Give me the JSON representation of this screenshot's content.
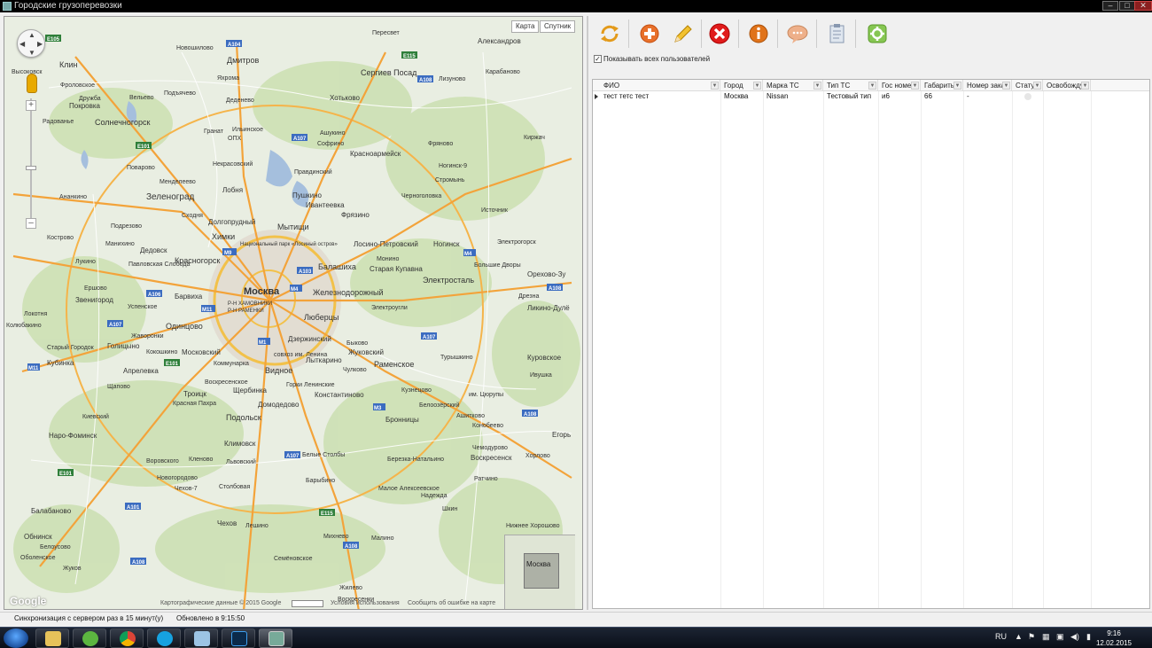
{
  "window": {
    "title": "Городские грузоперевозки",
    "controls": {
      "minimize": "–",
      "maximize": "□",
      "close": "✕"
    }
  },
  "map": {
    "type_buttons": {
      "map": "Карта",
      "satellite": "Спутник"
    },
    "pan_arrows": {
      "up": "▲",
      "down": "▼",
      "left": "◀",
      "right": "▶"
    },
    "zoom": {
      "in": "+",
      "out": "–"
    },
    "labels": {
      "peresvet": "Пересвет",
      "aleksandrov": "Александров",
      "novoshilovo": "Новошиловo",
      "dmitrov": "Дмитров",
      "sergiev_posad": "Сергиев Посад",
      "klin": "Клин",
      "frolovskoe": "Фроловское",
      "vysokovsk": "Высоковск",
      "yakhroma": "Яхрома",
      "karabanovo": "Карабаново",
      "lyzhino": "Лизуново",
      "druzhba": "Дружба",
      "velevo": "Вельево",
      "podyachevo": "Подъячево",
      "deledovo": "Деденево",
      "khotkovo": "Хотьково",
      "pokrovka": "Покровка",
      "solnechnogorsk": "Солнечногорск",
      "radovanye": "Радованье",
      "granat": "Гранат",
      "ashukino": "Ашукино",
      "kirzhach": "Киржач",
      "ilyinskoe": "Ильинское",
      "opkh": "ОПХ",
      "sofrino": "Софрино",
      "fryanovo": "Фряново",
      "nekrasovsky": "Некрасовский",
      "krasnoarmeysk": "Красноармейск",
      "povarovo": "Поварово",
      "pravdinsky": "Правдинский",
      "noginsk9": "Ногинск-9",
      "mendeleevo": "Менделеево",
      "stromyn": "Стромынь",
      "lobnya": "Лобня",
      "pushkino": "Пушкино",
      "anankino": "Ананкино",
      "zelenograd": "Зеленоград",
      "ivanteevka": "Ивантеевка",
      "chernogolovka": "Черноголовка",
      "skhodnya": "Сходня",
      "dolgoprudny": "Долгопрудный",
      "fryazino": "Фрязино",
      "istochnik": "Источник",
      "podrosno": "Подрезово",
      "khimki": "Химки",
      "mytishchi": "Мытищи",
      "park": "Национальный парк «Лосиный остров»",
      "losino": "Лосино-Петровский",
      "noginsk": "Ногинск",
      "elektrogorsk": "Электрогорск",
      "kostrovo": "Кострово",
      "manikhino": "Манихино",
      "dedovsk": "Дедовск",
      "monino": "Монино",
      "lukino": "Лукино",
      "pavlovskaya": "Павловская Слобода",
      "krasnogorsk": "Красногорск",
      "balashikha": "Балашиха",
      "bolshie_dvory": "Большие Дворы",
      "orekhovo": "Орехово-Зу",
      "staraya_kupavna": "Старая Купавна",
      "ershovo": "Ершово",
      "barvikha": "Барвиха",
      "moskva": "Москва",
      "zheleznodorozhny": "Железнодорожный",
      "elektrostal": "Электросталь",
      "zvenigorod": "Звенигород",
      "drezna": "Дрезна",
      "uspenskoe": "Успенское",
      "khamovniki": "Р-Н ХАМОВНИКИ",
      "ramenki": "Р-Н РАМЕНКИ",
      "lyubertsy": "Люберцы",
      "elektrougli": "Электроугли",
      "likino": "Ликино-Дулё",
      "lokotnya": "Локотня",
      "odintsovo": "Одинцово",
      "zhavoronki": "Жаворонки",
      "dzerzhinsky": "Дзержинский",
      "kolyubakino": "Колюбакино",
      "golitsyno": "Голицыно",
      "bykovo": "Быково",
      "zhukovsky": "Жуковский",
      "stary_gorodok": "Старый Городок",
      "kokoshkino": "Кокошкино",
      "moskovsky": "Московский",
      "turyshkino": "Турышкино",
      "kurovskoe": "Куровское",
      "kubinka": "Кубинка",
      "aprelevka": "Апрелевка",
      "kommunarka": "Коммунарка",
      "vidnoe": "Видное",
      "sovkhoz": "совхоз им. Ленина",
      "lytkarino": "Лыткарино",
      "chulkovo": "Чулково",
      "ramenskoe": "Раменское",
      "ivushka": "Ивушка",
      "shchapovo": "Щапово",
      "voskresenskoe": "Воскресенское",
      "gorki": "Горки Ленинские",
      "kuznetsovo": "Кузнецово",
      "troitsk": "Троицк",
      "shcherbinka": "Щербинка",
      "konstantinovo": "Константиново",
      "churupy": "им. Цюрупы",
      "krasnaya_pakhra": "Красная Пахра",
      "domodedovo": "Домодедово",
      "beloozersky": "Белоозёрский",
      "kievsky": "Киевский",
      "podolsk": "Подольск",
      "bronnitsy": "Бронницы",
      "ashitkovo": "Ашитково",
      "konobeevo": "Конобеево",
      "egorievsk": "Егорь",
      "naro_fominsk": "Наро-Фоминск",
      "klimovsk": "Климовск",
      "chemodurovo": "Чемодурово",
      "vorovsky": "Воровского",
      "klenovo": "Кленово",
      "lvovsky": "Львовский",
      "belye_stolby": "Белые Столбы",
      "berezka": "Березка-Натальино",
      "voskresensk": "Воскресенск",
      "khorlovo": "Хорлово",
      "novogorodovo": "Новогородово",
      "barybino": "Барыбино",
      "ratchino": "Ратчино",
      "chekhov7": "Чехов-7",
      "stolbovaya": "Столбовая",
      "maloe": "Малое Алексеевское",
      "nadezhda": "Надежда",
      "shkin": "Шкин",
      "balabanovo": "Балабаново",
      "chekhov": "Чехов",
      "leshino": "Лешино",
      "nizhne": "Нижнее Хорошово",
      "obninsk": "Обнинск",
      "belousovo": "Белоусово",
      "mikhnevo": "Михнево",
      "malino": "Малино",
      "semenovskoe": "Семёновское",
      "zhukov": "Жуков",
      "zhilevo": "Жилево",
      "voskresenki": "Воскресенки",
      "obolenskoe": "Оболенское"
    },
    "shields": [
      "E105",
      "A104",
      "E115",
      "A108",
      "A107",
      "E101",
      "A106",
      "M9",
      "M10",
      "M11",
      "M1",
      "M2",
      "M3",
      "M4",
      "M5",
      "M7",
      "M8",
      "A103",
      "A101",
      "A113",
      "A105"
    ],
    "mini_map_label": "Москва",
    "footer": {
      "copyright": "Картографические данные © 2015 Google",
      "scale": "",
      "terms": "Условия использования",
      "report": "Сообщить об ошибке на карте"
    },
    "logo": "Google"
  },
  "toolbar": {
    "buttons": [
      {
        "name": "refresh-button",
        "icon": "refresh-icon",
        "color": "#f0a020"
      },
      {
        "name": "add-button",
        "icon": "plus-icon",
        "color": "#e86a1c"
      },
      {
        "name": "edit-button",
        "icon": "pencil-icon",
        "color": "#e8b020"
      },
      {
        "name": "delete-button",
        "icon": "close-icon",
        "color": "#d81818"
      },
      {
        "name": "info-button",
        "icon": "info-icon",
        "color": "#e07010"
      },
      {
        "name": "message-button",
        "icon": "chat-icon",
        "color": "#e8a070"
      },
      {
        "name": "report-button",
        "icon": "clipboard-icon",
        "color": "#8898b0"
      },
      {
        "name": "settings-button",
        "icon": "gear-icon",
        "color": "#7ac040"
      }
    ]
  },
  "show_all_users": {
    "checked": "✓",
    "label": "Показывать всех пользователей"
  },
  "grid": {
    "columns": [
      "ФИО",
      "Город",
      "Марка ТС",
      "Тип ТС",
      "Гос номер",
      "Габариты",
      "Номер заказ",
      "Статус",
      "Освобождус"
    ],
    "rows": [
      {
        "fio": "тест тетс тест",
        "city": "Москва",
        "brand": "Nissan",
        "type": "Тестовый тип",
        "plate": "и6",
        "size": "66",
        "order": "-",
        "status": "",
        "free": ""
      }
    ]
  },
  "statusbar": {
    "sync": "Синхронизация с сервером раз в 15 минут(у)",
    "updated": "Обновлено в 9:15:50"
  },
  "taskbar": {
    "apps": [
      "explorer",
      "utorrent",
      "chrome",
      "skype",
      "notepad",
      "photoshop",
      "app"
    ],
    "lang": "RU",
    "time": "9:16",
    "date": "12.02.2015"
  }
}
